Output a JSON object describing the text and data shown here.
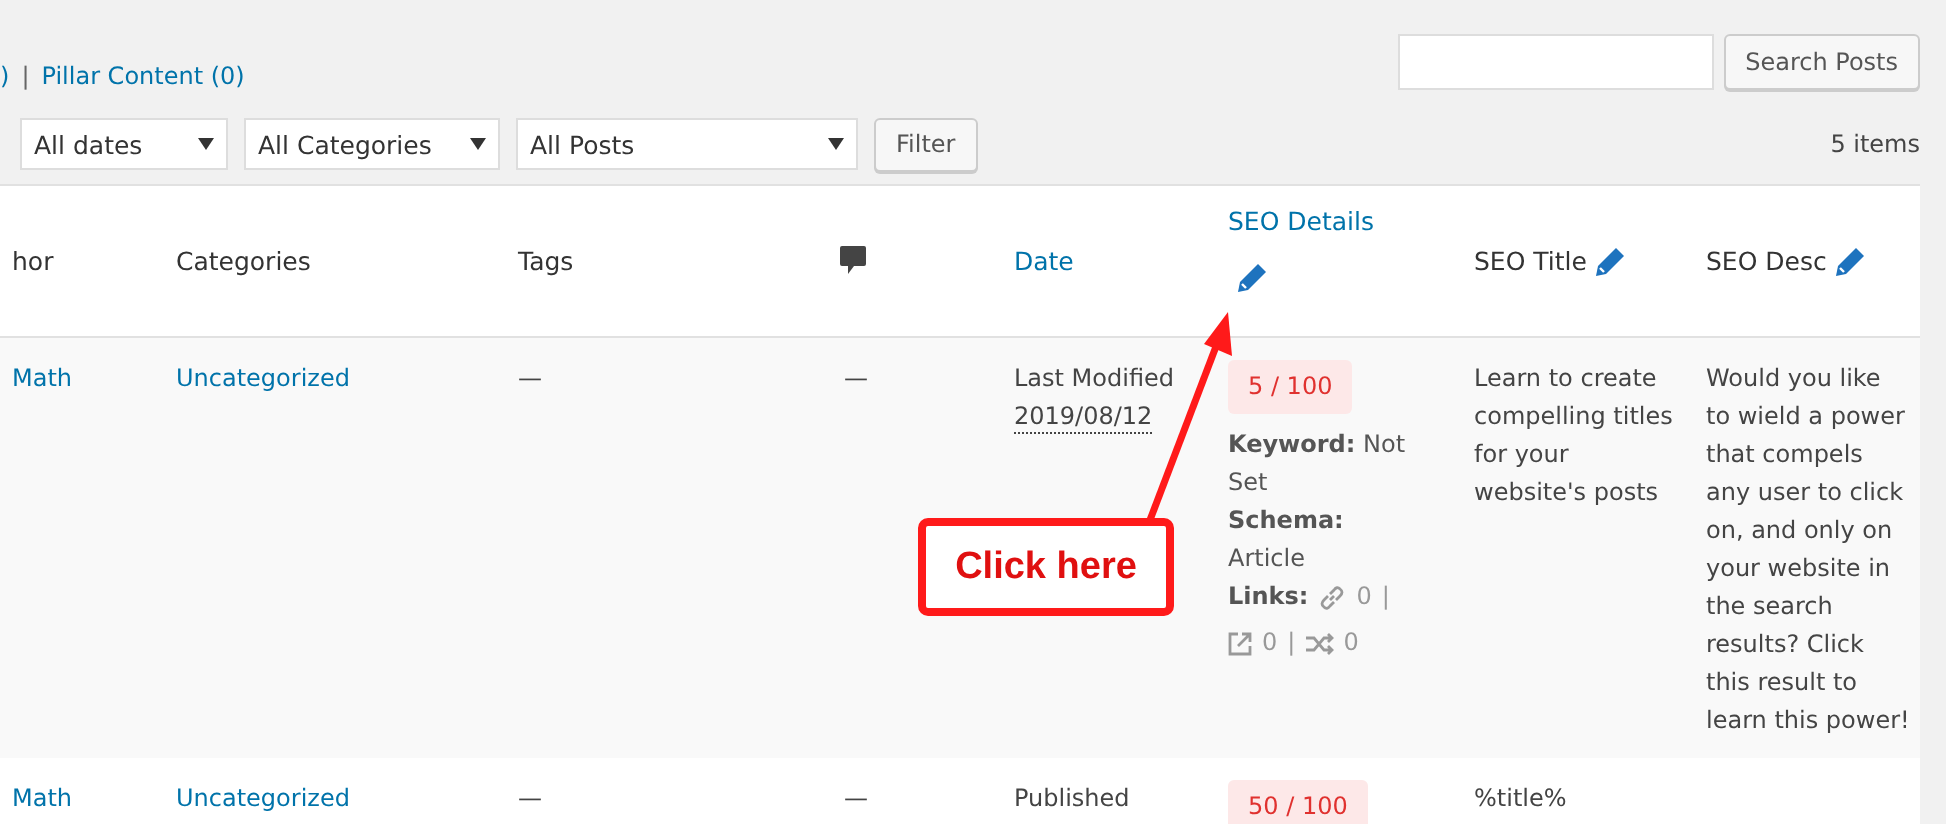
{
  "views": [
    {
      "label": ")"
    },
    {
      "label": "Pillar Content (0)"
    }
  ],
  "view_separator": "|",
  "search": {
    "button": "Search Posts"
  },
  "filters": {
    "selects": [
      "All dates",
      "All Categories",
      "All Posts"
    ],
    "button": "Filter",
    "count": "5 items"
  },
  "table": {
    "columns": [
      {
        "label": "hor",
        "kind": "text"
      },
      {
        "label": "Categories",
        "kind": "text"
      },
      {
        "label": "Tags",
        "kind": "text"
      },
      {
        "kind": "comments"
      },
      {
        "label": "Date",
        "kind": "link"
      },
      {
        "label": "SEO Details",
        "kind": "link-edit"
      },
      {
        "label": "SEO Title",
        "kind": "text-edit"
      },
      {
        "label": "SEO Desc",
        "kind": "text-edit"
      }
    ],
    "rows": [
      {
        "author": "Math",
        "category": "Uncategorized",
        "tags": "—",
        "comments": "—",
        "date_status": "Last Modified",
        "date": "2019/08/12",
        "score": "5 / 100",
        "keyword_label": "Keyword:",
        "keyword": "Not Set",
        "schema_label": "Schema:",
        "schema": "Article",
        "links_label": "Links:",
        "links_separator": "|",
        "internal": "0",
        "external": "0",
        "redirects": "0",
        "seo_title": "Learn to create compelling titles for your website's posts",
        "seo_desc": "Would you like to wield a power that compels any user to click on, and only on your website in the search results? Click this result to learn this power!"
      },
      {
        "author": "Math",
        "category": "Uncategorized",
        "tags": "—",
        "comments": "—",
        "date_status": "Published",
        "score": "50 / 100",
        "seo_title": "%title%"
      }
    ]
  },
  "callout": {
    "text": "Click here"
  }
}
